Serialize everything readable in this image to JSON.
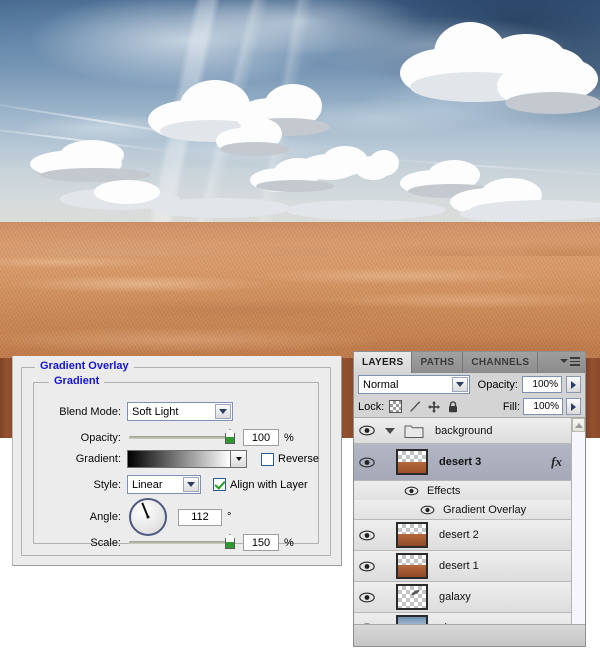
{
  "canvas": {
    "scene": "desert dunes under cloudy blue sky",
    "alt": "Sky with cumulus and cirrus clouds above orange sand dunes"
  },
  "gradient_dialog": {
    "outer_group_title": "Gradient Overlay",
    "inner_group_title": "Gradient",
    "fields": {
      "blend_mode_label": "Blend Mode:",
      "blend_mode_value": "Soft Light",
      "opacity_label": "Opacity:",
      "opacity_value": "100",
      "opacity_unit": "%",
      "gradient_label": "Gradient:",
      "gradient_from": "#000000",
      "gradient_to": "#ffffff",
      "reverse_label": "Reverse",
      "reverse_checked": false,
      "style_label": "Style:",
      "style_value": "Linear",
      "align_with_layer_label": "Align with Layer",
      "align_with_layer_checked": true,
      "angle_label": "Angle:",
      "angle_value": "112",
      "angle_unit": "°",
      "scale_label": "Scale:",
      "scale_value": "150",
      "scale_unit": "%"
    },
    "title_color": "#1414d2"
  },
  "layers_panel": {
    "tabs": [
      {
        "label": "LAYERS",
        "active": true
      },
      {
        "label": "PATHS",
        "active": false
      },
      {
        "label": "CHANNELS",
        "active": false
      }
    ],
    "blend_mode": "Normal",
    "opacity_label": "Opacity:",
    "opacity_value": "100%",
    "lock_label": "Lock:",
    "lock_icons": [
      "lock-transparent-pixels-icon",
      "lock-image-pixels-icon",
      "lock-position-icon",
      "lock-all-icon"
    ],
    "fill_label": "Fill:",
    "fill_value": "100%",
    "rows": [
      {
        "name": "background",
        "type": "group",
        "visible": true,
        "selected": false,
        "expanded": true,
        "indent": 0
      },
      {
        "name": "desert 3",
        "type": "layer",
        "visible": true,
        "selected": true,
        "has_fx": true,
        "indent": 0,
        "thumb": "desert3"
      },
      {
        "name": "Effects",
        "type": "effects",
        "visible": true,
        "selected": false,
        "indent": 1
      },
      {
        "name": "Gradient Overlay",
        "type": "effect",
        "visible": true,
        "selected": false,
        "indent": 2
      },
      {
        "name": "desert 2",
        "type": "layer",
        "visible": true,
        "selected": false,
        "indent": 0,
        "thumb": "desert"
      },
      {
        "name": "desert 1",
        "type": "layer",
        "visible": true,
        "selected": false,
        "indent": 0,
        "thumb": "desert"
      },
      {
        "name": "galaxy",
        "type": "layer",
        "visible": true,
        "selected": false,
        "indent": 0,
        "thumb": "galaxy"
      },
      {
        "name": "sky",
        "type": "layer",
        "visible": true,
        "selected": false,
        "indent": 0,
        "thumb": "sky"
      }
    ]
  },
  "colors": {
    "dialog_bg": "#ececec",
    "group_title": "#1414d2",
    "panel_bg": "#d4d4d4",
    "selected_row": "#a9adbc",
    "backdrop_brown": "#8a4a2c",
    "slider_thumb_green": "#2e9b2e",
    "check_green": "#1f9b1f"
  }
}
